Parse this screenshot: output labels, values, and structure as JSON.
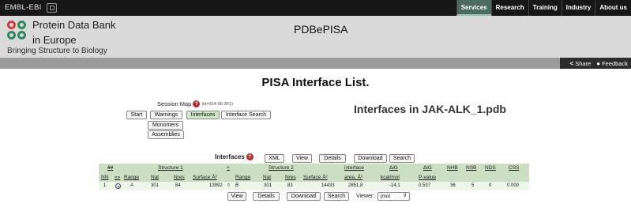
{
  "ebi_bar": {
    "logo": "EMBL-EBI",
    "nav": [
      "Services",
      "Research",
      "Training",
      "Industry",
      "About us"
    ],
    "active_nav": "Services"
  },
  "header": {
    "org_line1": "Protein Data Bank",
    "org_line2": "in Europe",
    "tagline": "Bringing Structure to Biology",
    "app_title": "PDBePISA"
  },
  "utility": {
    "share": "Share",
    "feedback": "Feedback"
  },
  "main": {
    "title": "PISA Interface List.",
    "session_map_label": "Session Map",
    "session_id": "(id=914-56-3F1)",
    "nav_buttons": {
      "start": "Start",
      "warnings": "Warnings",
      "interfaces": "Interfaces",
      "interface_search": "Interface Search",
      "monomers": "Monomers",
      "assemblies": "Assemblies"
    },
    "pdb_heading": "Interfaces in JAK-ALK_1.pdb"
  },
  "interfaces": {
    "label": "Interfaces",
    "top_buttons": {
      "xml": "XML",
      "view": "View",
      "details": "Details",
      "download": "Download",
      "search": "Search"
    },
    "group_headers": {
      "hash": "##",
      "structure1": "Structure 1",
      "x": "×",
      "structure2": "Structure 2",
      "interface_area": "interface",
      "dg": "ΔiG",
      "dg_p": "ΔiG",
      "nhb": "NHB",
      "nsb": "NSB",
      "nds": "NDS",
      "css": "CSS"
    },
    "sub_headers": {
      "nn": "NN",
      "sel": "«»",
      "range1": "Range",
      "nat1": "Nat",
      "nres1": "Nres",
      "surface1": "Surface Å²",
      "range2": "Range",
      "nat2": "Nat",
      "nres2": "Nres",
      "surface2": "Surface Å²",
      "area": "area, Å²",
      "kcal": "kcal/mol",
      "pvalue": "P-value"
    },
    "rows": [
      {
        "nn": "1",
        "range1": "A",
        "nat1": "301",
        "nres1": "84",
        "surface1": "13992",
        "sym": "◊",
        "range2": "B",
        "nat2": "301",
        "nres2": "83",
        "surface2": "14433",
        "area": "2851.8",
        "dg": "-14.1",
        "pvalue": "0.537",
        "nhb": "36",
        "nsb": "5",
        "nds": "0",
        "css": "0.000"
      }
    ],
    "bottom_buttons": {
      "view": "View",
      "details": "Details",
      "download": "Download",
      "search": "Search"
    },
    "viewer_label": "Viewer:",
    "viewer_value": "jmol"
  },
  "colors": {
    "ebi_bar": "#171717",
    "header_bg": "#dadada",
    "active_tab": "#4d6b61",
    "table_header": "#cddfc3",
    "table_row": "#eef6ea",
    "active_button": "#cfe8c6"
  }
}
